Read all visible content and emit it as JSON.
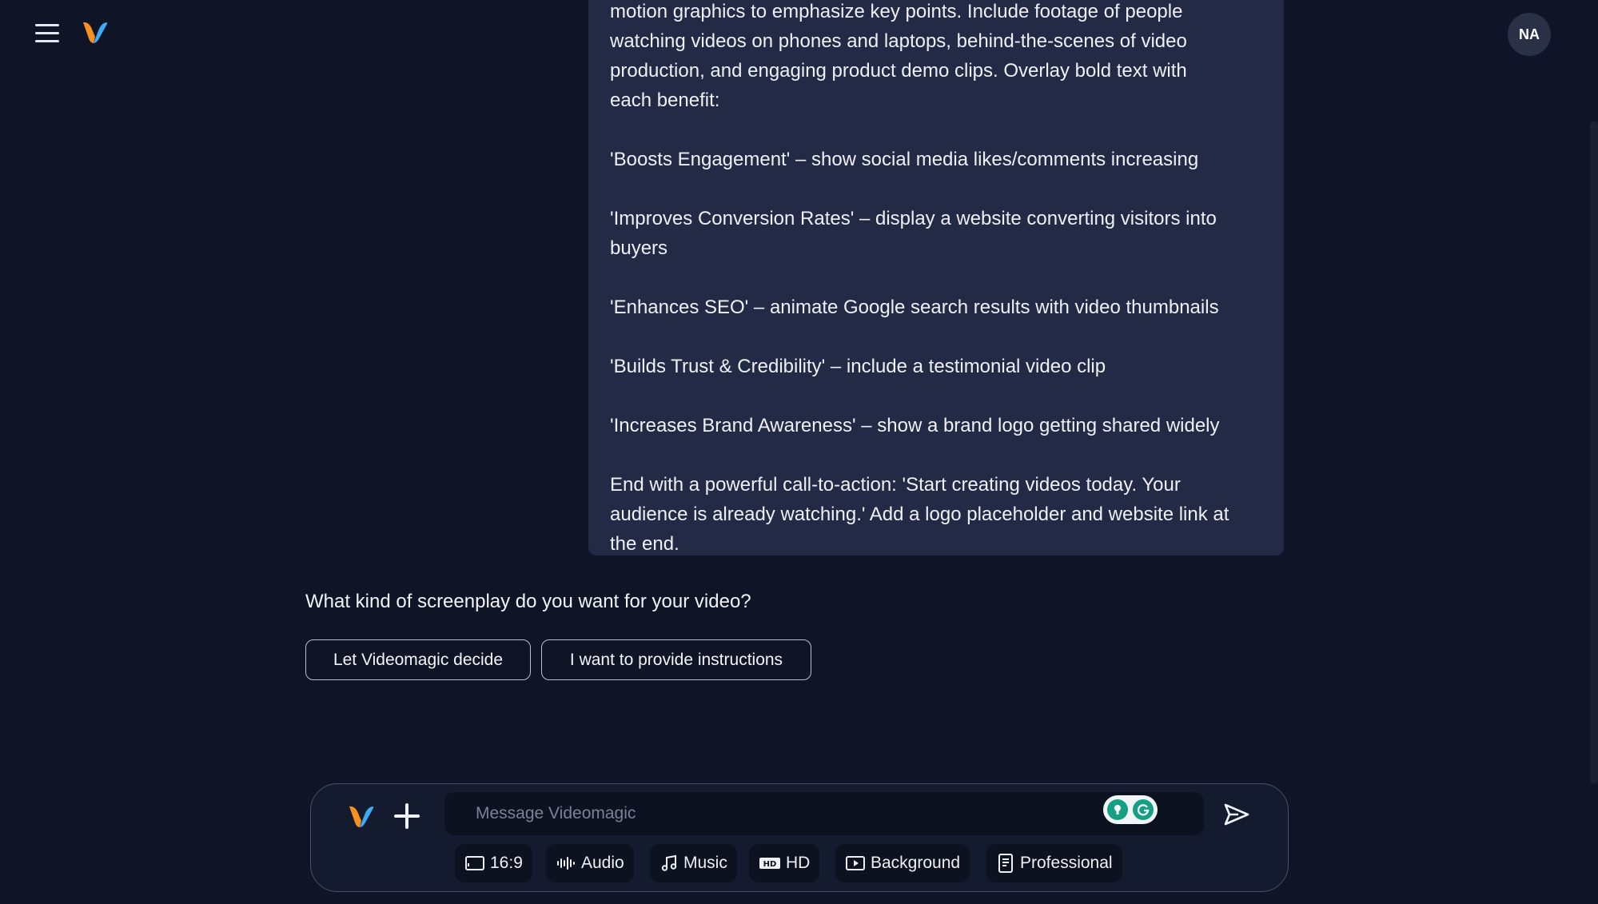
{
  "header": {
    "avatar_initials": "NA"
  },
  "prompt": {
    "lines": [
      "motion graphics to emphasize key points. Include footage of people",
      "watching videos on phones and laptops, behind-the-scenes of video",
      "production, and engaging product demo clips. Overlay bold text with",
      "each benefit:",
      "",
      "'Boosts Engagement' – show social media likes/comments increasing",
      "",
      "'Improves Conversion Rates' – display a website converting visitors into",
      "buyers",
      "",
      "'Enhances SEO' – animate Google search results with video thumbnails",
      "",
      "'Builds Trust & Credibility' – include a testimonial video clip",
      "",
      "'Increases Brand Awareness' – show a brand logo getting shared widely",
      "",
      "End with a powerful call-to-action: 'Start creating videos today. Your",
      "audience is already watching.' Add a logo placeholder and website link at",
      "the end."
    ]
  },
  "assistant": {
    "question": "What kind of screenplay do you want for your video?",
    "choices": [
      "Let Videomagic decide",
      "I want to provide instructions"
    ]
  },
  "composer": {
    "placeholder": "Message Videomagic",
    "options": [
      "16:9",
      "Audio",
      "Music",
      "HD",
      "Background",
      "Professional"
    ]
  },
  "colors": {
    "background": "#0f1526",
    "bubble": "#232a45",
    "logo_orange": "#f7901e",
    "logo_blue": "#3fa9f5"
  }
}
